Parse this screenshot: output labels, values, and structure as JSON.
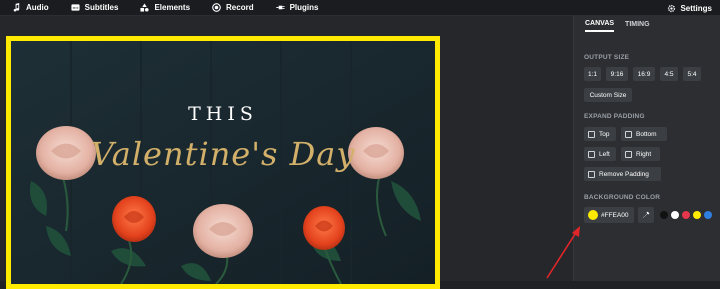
{
  "topbar": {
    "items": [
      {
        "label": "Audio"
      },
      {
        "label": "Subtitles"
      },
      {
        "label": "Elements"
      },
      {
        "label": "Record"
      },
      {
        "label": "Plugins"
      }
    ],
    "settings_label": "Settings"
  },
  "canvas": {
    "title_line1": "THIS",
    "title_line2": "Valentine's Day",
    "border_color": "#FFEA00"
  },
  "panel": {
    "tabs": [
      {
        "label": "CANVAS"
      },
      {
        "label": "TIMING"
      }
    ],
    "output_size_label": "OUTPUT SIZE",
    "sizes": [
      "1:1",
      "9:16",
      "16:9",
      "4:5",
      "5:4"
    ],
    "custom_size_label": "Custom Size",
    "expand_padding_label": "EXPAND PADDING",
    "padding": {
      "top": "Top",
      "bottom": "Bottom",
      "left": "Left",
      "right": "Right",
      "remove": "Remove Padding"
    },
    "background_color_label": "BACKGROUND COLOR",
    "background_value": "#FFEA00",
    "palette": [
      "#111111",
      "#ffffff",
      "#e5364b",
      "#ffea00",
      "#2f7fe0"
    ]
  },
  "icons": {
    "audio": "music-note-icon",
    "subtitles": "subtitles-icon",
    "elements": "shapes-icon",
    "record": "record-icon",
    "plugins": "plug-icon",
    "settings": "gear-icon",
    "eyedropper": "eyedropper-icon"
  }
}
